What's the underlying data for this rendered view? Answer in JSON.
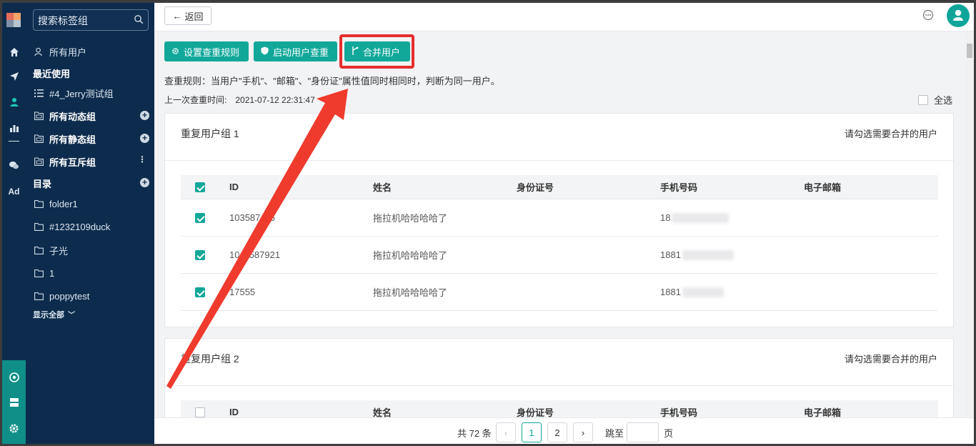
{
  "search": {
    "placeholder": "搜索标签组"
  },
  "sidebar": {
    "all_users": "所有用户",
    "recent_heading": "最近使用",
    "recent_items": [
      "#4_Jerry测试组"
    ],
    "groups": [
      "所有动态组",
      "所有静态组",
      "所有互斥组"
    ],
    "catalog_heading": "目录",
    "folders": [
      "folder1",
      "#1232109duck",
      "子光",
      "1",
      "poppytest"
    ],
    "show_all": "显示全部"
  },
  "rail": {
    "ad_label": "Ad"
  },
  "topbar": {
    "back_label": "返回"
  },
  "toolbar": {
    "set_rule_label": "设置查重规则",
    "start_check_label": "启动用户查重",
    "merge_label": "合并用户"
  },
  "info": {
    "rule_text": "查重规则：当用户\"手机\"、\"邮箱\"、\"身份证\"属性值同时相同时，判断为同一用户。",
    "last_check_label": "上一次查重时间:",
    "last_check_time": "2021-07-12 22:31:47",
    "select_all_label": "全选"
  },
  "columns": [
    "ID",
    "姓名",
    "身份证号",
    "手机号码",
    "电子邮箱"
  ],
  "groups": [
    {
      "title": "重复用户组 1",
      "hint": "请勾选需要合并的用户",
      "header_checked": true,
      "rows": [
        {
          "id": "103587",
          "id_tail": "85",
          "name": "拖拉机哈哈哈哈了",
          "id_card": "",
          "phone": "18",
          "email": "",
          "checked": true
        },
        {
          "id": "10",
          "id_tail": "3587921",
          "name": "拖拉机哈哈哈哈了",
          "id_card": "",
          "phone": "1881",
          "email": "",
          "checked": true
        },
        {
          "id": "17555",
          "id_tail": "",
          "name": "拖拉机哈哈哈哈了",
          "id_card": "",
          "phone": "1881",
          "email": "",
          "checked": true
        }
      ]
    },
    {
      "title": "重复用户组 2",
      "hint": "请勾选需要合并的用户",
      "header_checked": false,
      "rows": []
    }
  ],
  "pagination": {
    "total_label": "共 72 条",
    "pages": [
      "1",
      "2"
    ],
    "current": "1",
    "jump_label": "跳至",
    "unit_label": "页"
  },
  "colors": {
    "accent": "#11a89a",
    "sidebar": "#0d2c4d",
    "highlight": "#e62d2d"
  },
  "annotation": {
    "type": "red-arrow",
    "points_to": "merge-users-button"
  }
}
